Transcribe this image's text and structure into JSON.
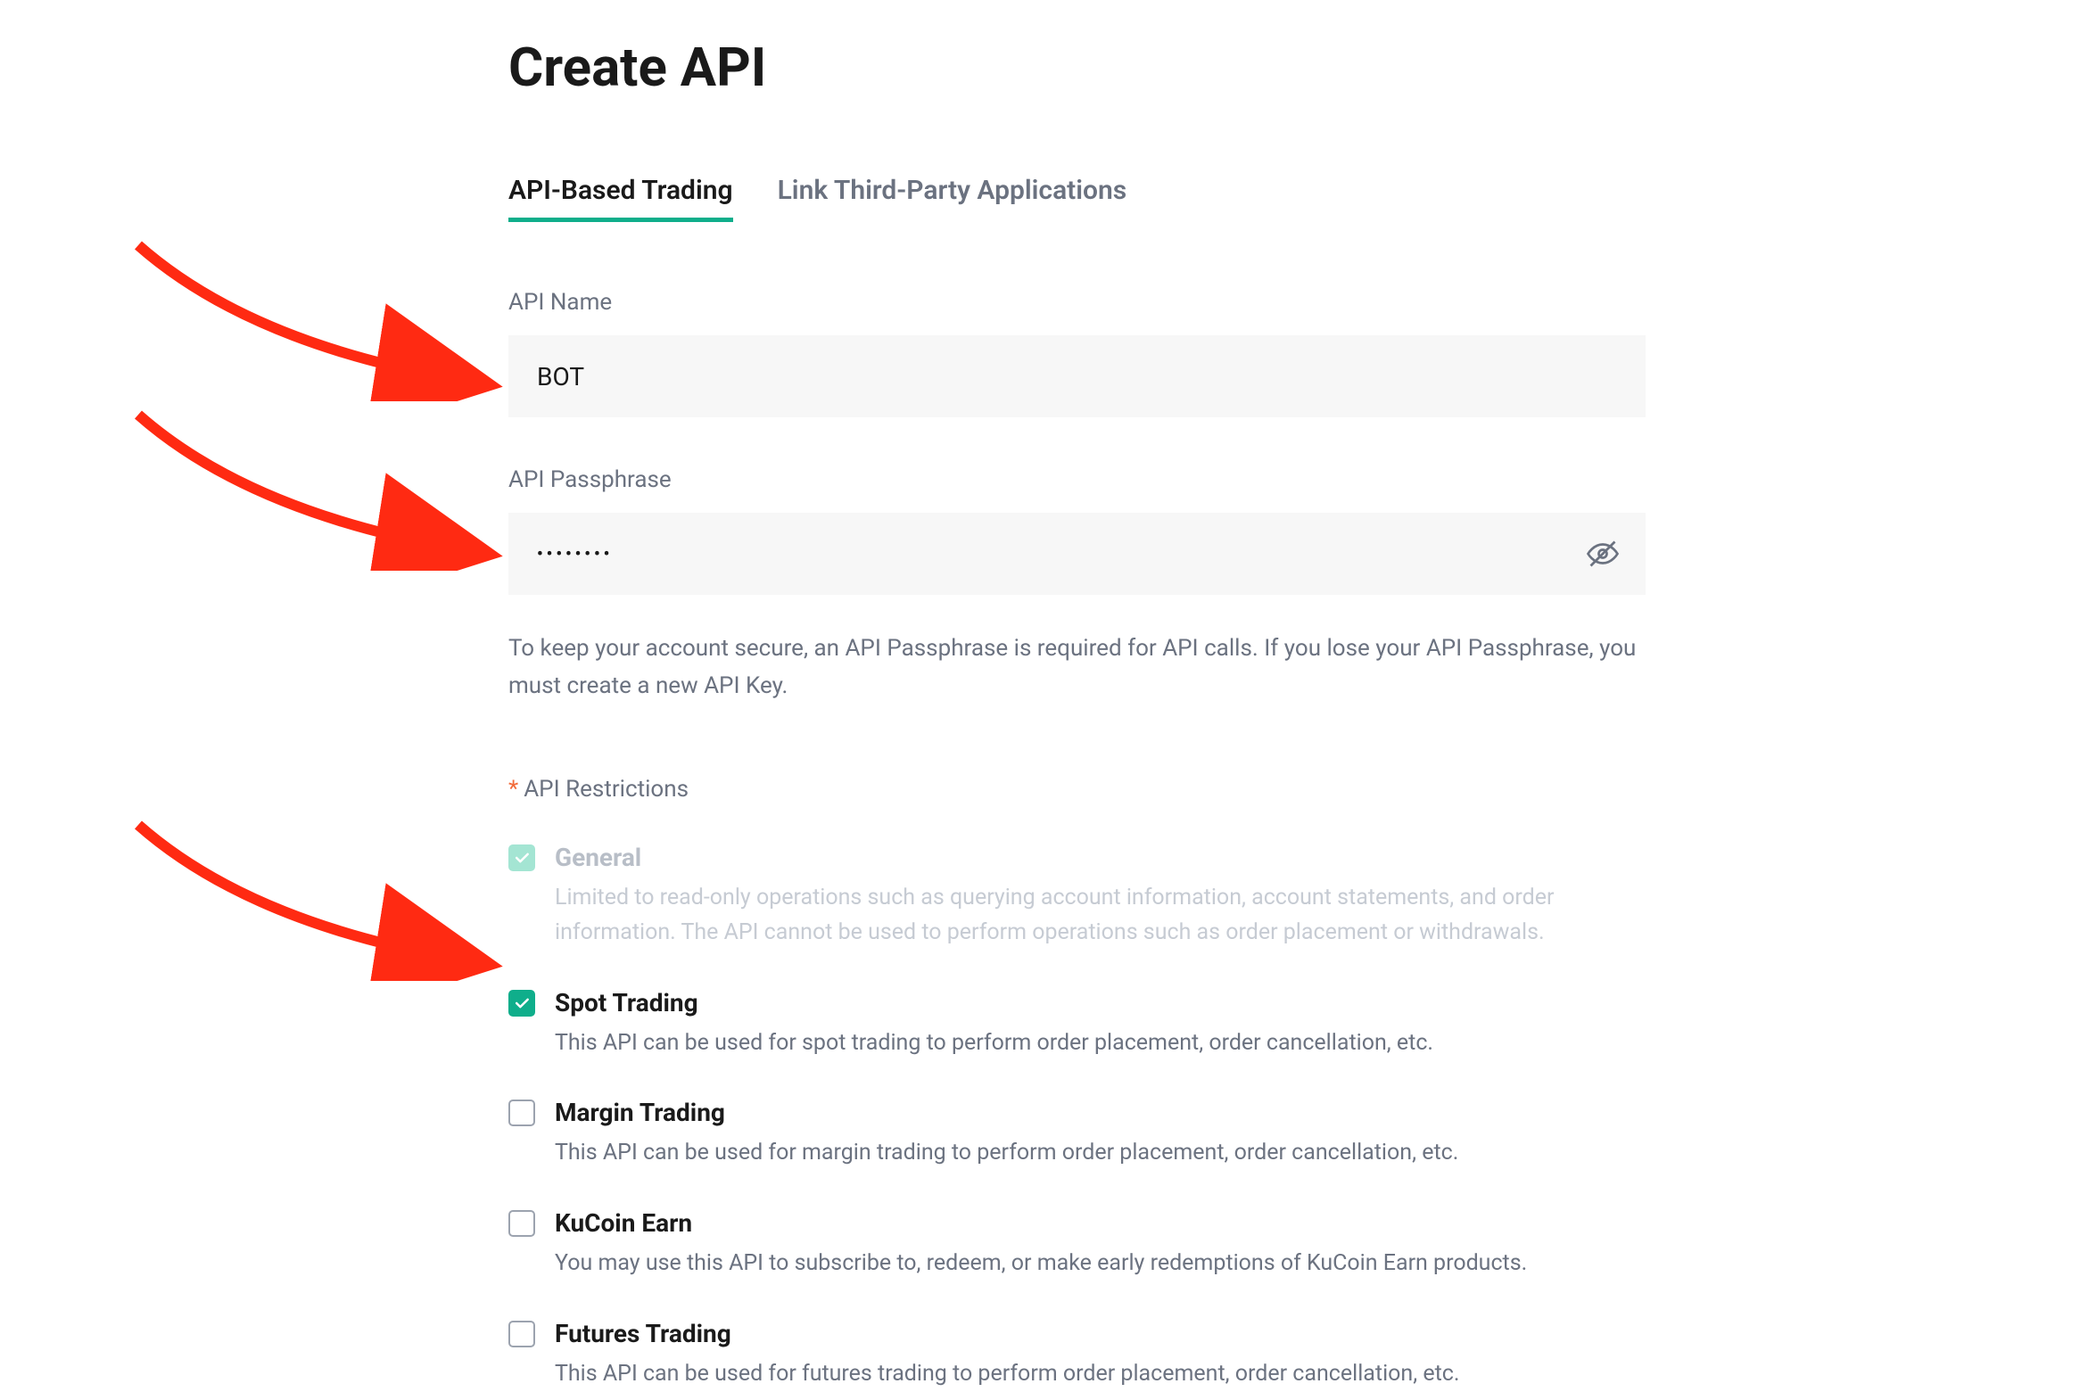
{
  "page": {
    "title": "Create API"
  },
  "tabs": [
    {
      "label": "API-Based Trading",
      "active": true
    },
    {
      "label": "Link Third-Party Applications",
      "active": false
    }
  ],
  "fields": {
    "apiName": {
      "label": "API Name",
      "value": "BOT"
    },
    "apiPassphrase": {
      "label": "API Passphrase",
      "value": "••••••••",
      "helper": "To keep your account secure, an API Passphrase is required for API calls. If you lose your API Passphrase, you must create a new API Key."
    }
  },
  "restrictions": {
    "label": "API Restrictions",
    "items": [
      {
        "title": "General",
        "desc": "Limited to read-only operations such as querying account information, account statements, and order information. The API cannot be used to perform operations such as order placement or withdrawals.",
        "checked": true,
        "disabled": true
      },
      {
        "title": "Spot Trading",
        "desc": "This API can be used for spot trading to perform order placement, order cancellation, etc.",
        "checked": true,
        "disabled": false
      },
      {
        "title": "Margin Trading",
        "desc": "This API can be used for margin trading to perform order placement, order cancellation, etc.",
        "checked": false,
        "disabled": false
      },
      {
        "title": "KuCoin Earn",
        "desc": "You may use this API to subscribe to, redeem, or make early redemptions of KuCoin Earn products.",
        "checked": false,
        "disabled": false
      },
      {
        "title": "Futures Trading",
        "desc": "This API can be used for futures trading to perform order placement, order cancellation, etc.",
        "checked": false,
        "disabled": false
      }
    ]
  }
}
